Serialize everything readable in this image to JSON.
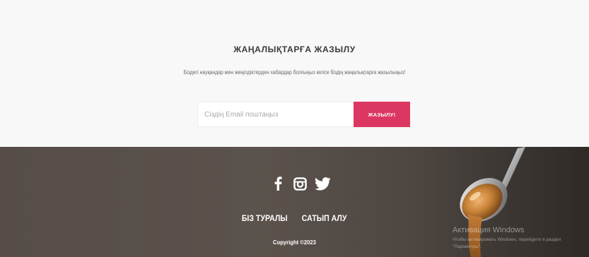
{
  "newsletter": {
    "title": "ЖАҢАЛЫҚТАРҒА ЖАЗЫЛУ",
    "subtitle": "Біздегі науқандар мен жеңілдіктерден хабардар болғыңыз келсе біздің жаңалықтарға жазылыңыз!",
    "email_placeholder": "Сіздің Email поштаңыз",
    "email_value": "",
    "subscribe_label": "ЖАЗЫЛУ!"
  },
  "footer": {
    "social_icons": [
      "facebook-icon",
      "instagram-icon",
      "twitter-icon"
    ],
    "links": [
      "БІЗ ТУРАЛЫ",
      "САТЫП АЛУ"
    ],
    "copyright": "Copyright ©2023"
  },
  "watermark": {
    "title": "Активация Windows",
    "text": "Чтобы активировать Windows, перейдите в раздел \"Параметры\"."
  },
  "colors": {
    "accent": "#db3762",
    "footer_bg": "#564d48",
    "newsletter_bg": "#f8f8f8"
  }
}
